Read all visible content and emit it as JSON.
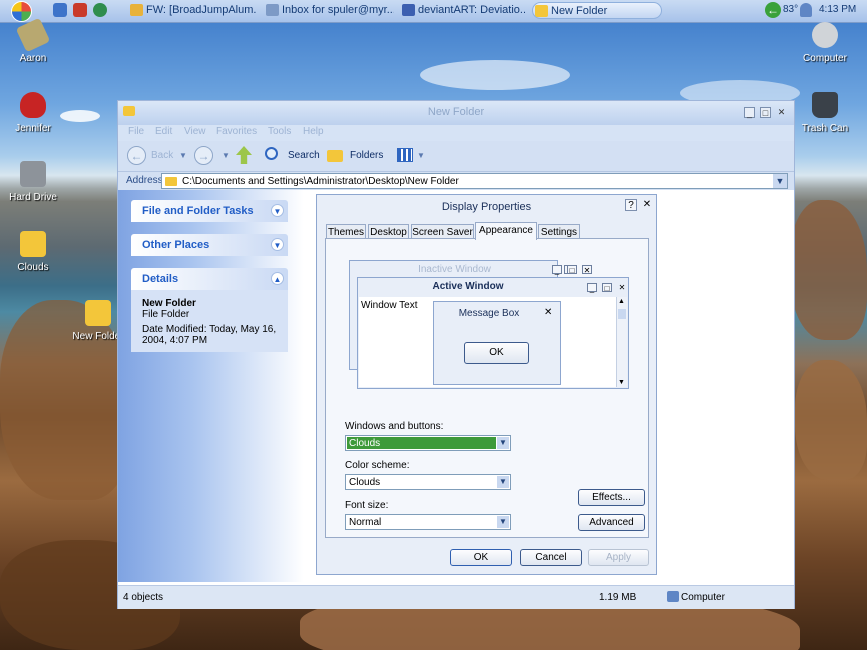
{
  "taskbar": {
    "buttons": [
      {
        "label": "FW: [BroadJumpAlum...",
        "icon": "outlook-mail-icon"
      },
      {
        "label": "Inbox for spuler@myr...",
        "icon": "mail-icon"
      },
      {
        "label": "deviantART: Deviatio...",
        "icon": "browser-icon"
      },
      {
        "label": "New Folder",
        "icon": "folder-icon"
      }
    ],
    "temperature": "83°",
    "time": "4:13 PM"
  },
  "desktop_icons": [
    {
      "label": "Aaron"
    },
    {
      "label": "Jennifer"
    },
    {
      "label": "Hard Drive"
    },
    {
      "label": "Clouds"
    },
    {
      "label": "New Folder"
    },
    {
      "label": "Computer"
    },
    {
      "label": "Trash Can"
    }
  ],
  "explorer": {
    "title": "New Folder",
    "menu": [
      "File",
      "Edit",
      "View",
      "Favorites",
      "Tools",
      "Help"
    ],
    "toolbar": {
      "back": "Back",
      "search": "Search",
      "folders": "Folders"
    },
    "address_label": "Address",
    "address": "C:\\Documents and Settings\\Administrator\\Desktop\\New Folder",
    "tasks": {
      "file_folder_tasks": "File and Folder Tasks",
      "other_places": "Other Places",
      "details": "Details",
      "details_name": "New Folder",
      "details_type": "File Folder",
      "details_modified": "Date Modified: Today, May 16, 2004, 4:07 PM"
    },
    "status": {
      "objects": "4 objects",
      "size": "1.19 MB",
      "location": "Computer"
    }
  },
  "dialog": {
    "title": "Display Properties",
    "help": "?",
    "close": "✕",
    "tabs": [
      "Themes",
      "Desktop",
      "Screen Saver",
      "Appearance",
      "Settings"
    ],
    "selected_tab": "Appearance",
    "preview": {
      "inactive": "Inactive Window",
      "active": "Active Window",
      "window_text": "Window Text",
      "message_box": "Message Box",
      "ok": "OK"
    },
    "windows_buttons_label": "Windows and buttons:",
    "windows_buttons_value": "Clouds",
    "color_scheme_label": "Color scheme:",
    "color_scheme_value": "Clouds",
    "font_size_label": "Font size:",
    "font_size_value": "Normal",
    "effects": "Effects...",
    "advanced": "Advanced",
    "ok": "OK",
    "cancel": "Cancel",
    "apply": "Apply"
  },
  "colors": {
    "accent": "#215dc6",
    "selection": "#3e9a3a"
  }
}
